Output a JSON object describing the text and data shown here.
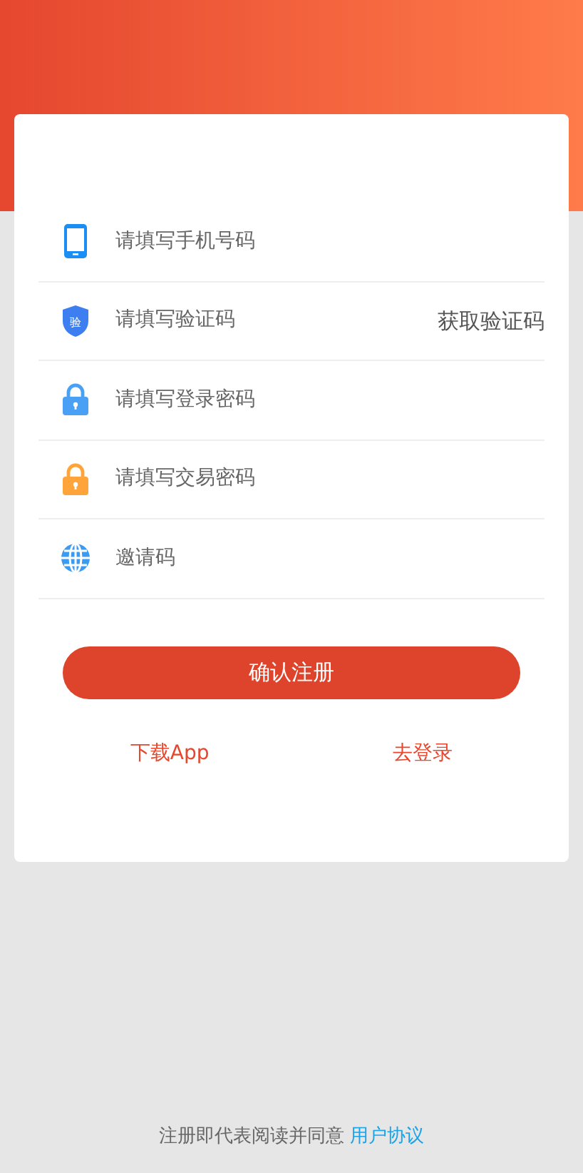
{
  "fields": [
    {
      "kind": "phone",
      "placeholder": "请填写手机号码"
    },
    {
      "kind": "code",
      "placeholder": "请填写验证码",
      "icon_glyph": "验",
      "action": "获取验证码"
    },
    {
      "kind": "lock-blue",
      "placeholder": "请填写登录密码"
    },
    {
      "kind": "lock-orange",
      "placeholder": "请填写交易密码"
    },
    {
      "kind": "globe",
      "placeholder": "邀请码"
    }
  ],
  "submit": "确认注册",
  "links": [
    "下载App",
    "去登录"
  ],
  "footer": {
    "text": "注册即代表阅读并同意",
    "link": "用户协议"
  }
}
